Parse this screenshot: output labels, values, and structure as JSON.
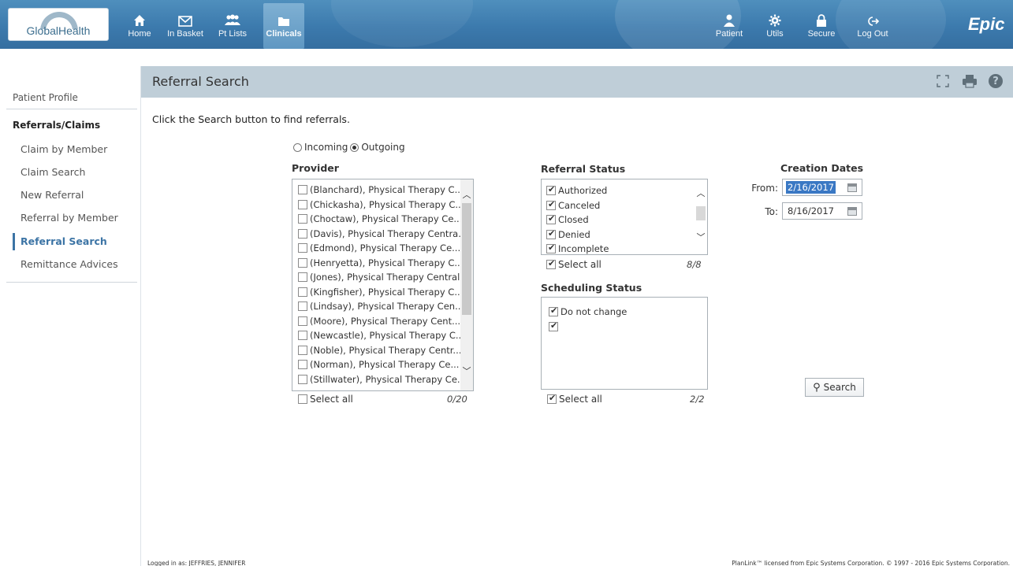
{
  "brand": {
    "logo_text": "GlobalHealth",
    "epic_text": "Epic"
  },
  "nav": {
    "left": [
      {
        "label": "Home",
        "icon": "home-icon"
      },
      {
        "label": "In Basket",
        "icon": "envelope-icon"
      },
      {
        "label": "Pt Lists",
        "icon": "people-icon"
      },
      {
        "label": "Clinicals",
        "icon": "folder-icon",
        "active": true
      }
    ],
    "right": [
      {
        "label": "Patient",
        "icon": "person-icon"
      },
      {
        "label": "Utils",
        "icon": "gear-icon"
      },
      {
        "label": "Secure",
        "icon": "lock-icon"
      },
      {
        "label": "Log Out",
        "icon": "logout-icon"
      }
    ]
  },
  "sidebar": {
    "patient_profile": "Patient Profile",
    "section": "Referrals/Claims",
    "items": [
      {
        "label": "Claim by Member"
      },
      {
        "label": "Claim Search"
      },
      {
        "label": "New Referral"
      },
      {
        "label": "Referral by Member"
      },
      {
        "label": "Referral Search",
        "active": true
      },
      {
        "label": "Remittance Advices"
      }
    ]
  },
  "page": {
    "title": "Referral Search",
    "instructions": "Click the Search button to find referrals.",
    "direction": {
      "incoming": "Incoming",
      "outgoing": "Outgoing",
      "selected": "outgoing"
    }
  },
  "provider": {
    "label": "Provider",
    "items": [
      "(Blanchard), Physical Therapy C...",
      "(Chickasha), Physical Therapy C...",
      "(Choctaw), Physical Therapy Ce...",
      "(Davis), Physical Therapy Centra...",
      "(Edmond), Physical Therapy Ce...",
      "(Henryetta), Physical Therapy C...",
      "(Jones), Physical Therapy Central",
      "(Kingfisher), Physical Therapy C...",
      "(Lindsay), Physical Therapy Cen...",
      "(Moore), Physical Therapy Cent...",
      "(Newcastle), Physical Therapy C...",
      "(Noble), Physical Therapy Centr...",
      "(Norman), Physical Therapy Ce...",
      "(Stillwater), Physical Therapy Ce..."
    ],
    "select_all": "Select all",
    "count": "0/20"
  },
  "referral_status": {
    "label": "Referral Status",
    "items": [
      "Authorized",
      "Canceled",
      "Closed",
      "Denied",
      "Incomplete"
    ],
    "select_all": "Select all",
    "count": "8/8"
  },
  "scheduling_status": {
    "label": "Scheduling Status",
    "items": [
      "Do not change",
      ""
    ],
    "select_all": "Select all",
    "count": "2/2"
  },
  "creation_dates": {
    "label": "Creation Dates",
    "from_label": "From:",
    "from_value": "2/16/2017",
    "to_label": "To:",
    "to_value": "8/16/2017"
  },
  "search_button": "Search",
  "footer": {
    "logged_in": "Logged in as: JEFFRIES, JENNIFER",
    "license": "PlanLink™ licensed from Epic Systems Corporation. © 1997 - 2016 Epic Systems Corporation."
  }
}
